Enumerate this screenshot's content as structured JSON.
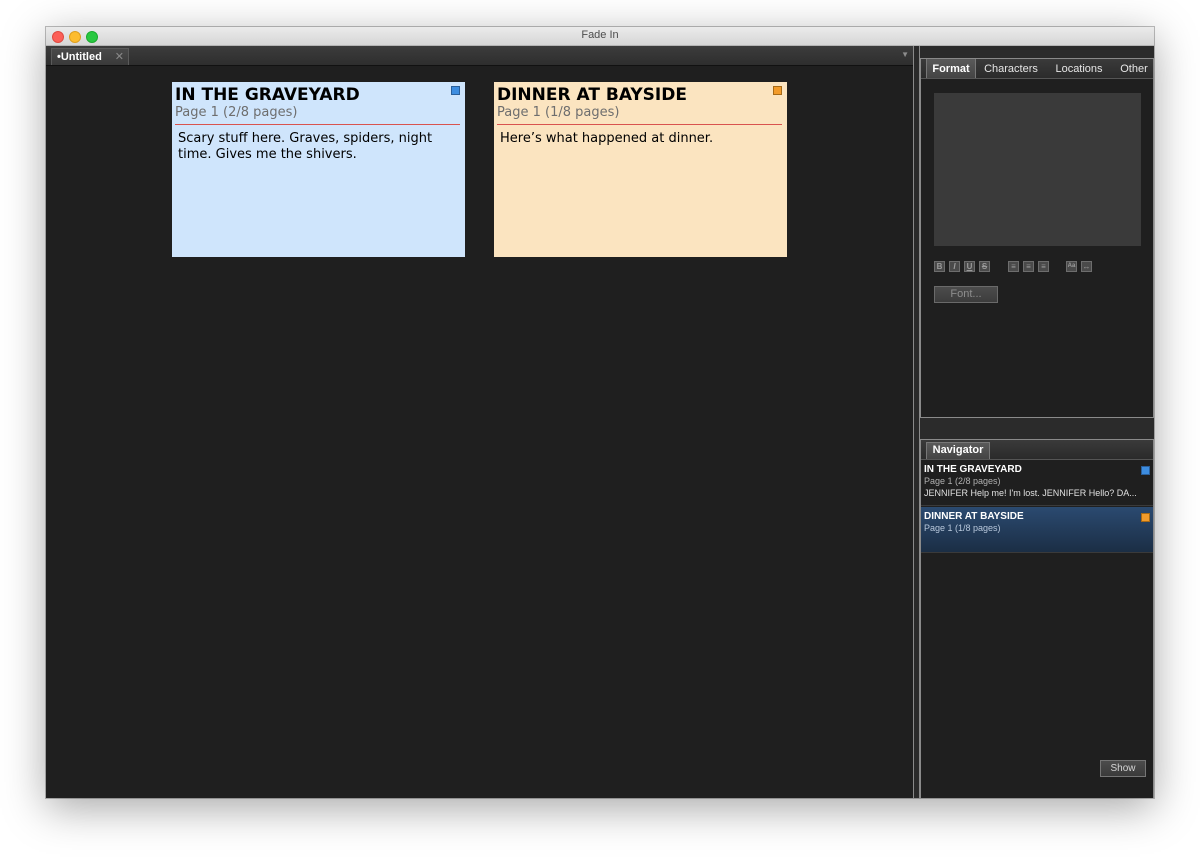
{
  "window": {
    "title": "Fade In"
  },
  "document_tab": {
    "label": "•Untitled",
    "close": "✕"
  },
  "cards": [
    {
      "title": "IN THE GRAVEYARD",
      "pages": "Page 1 (2/8 pages)",
      "body": "Scary stuff here. Graves, spiders, night time. Gives me the shivers.",
      "color": "#cfe5fc",
      "swatch": "#3d8de0"
    },
    {
      "title": "DINNER AT BAYSIDE",
      "pages": "Page 1 (1/8 pages)",
      "body": "Here’s what happened at dinner.",
      "color": "#fbe4c0",
      "swatch": "#f29b2a"
    }
  ],
  "format_panel": {
    "tabs": [
      "Format",
      "Characters",
      "Locations",
      "Other"
    ],
    "active_tab": "Format",
    "icons": [
      "B",
      "I",
      "U",
      "S",
      "≡",
      "≡",
      "≡",
      "Aa",
      "↔"
    ],
    "font_button": "Font..."
  },
  "navigator": {
    "tab": "Navigator",
    "items": [
      {
        "title": "IN THE GRAVEYARD",
        "pages": "Page 1 (2/8 pages)",
        "snippet": "JENNIFER  Help me! I'm lost.  JENNIFER  Hello?  DA...",
        "color": "#3d8de0"
      },
      {
        "title": "DINNER AT BAYSIDE",
        "pages": "Page 1 (1/8 pages)",
        "snippet": "",
        "color": "#f29b2a",
        "selected": true
      }
    ],
    "show_button": "Show"
  }
}
